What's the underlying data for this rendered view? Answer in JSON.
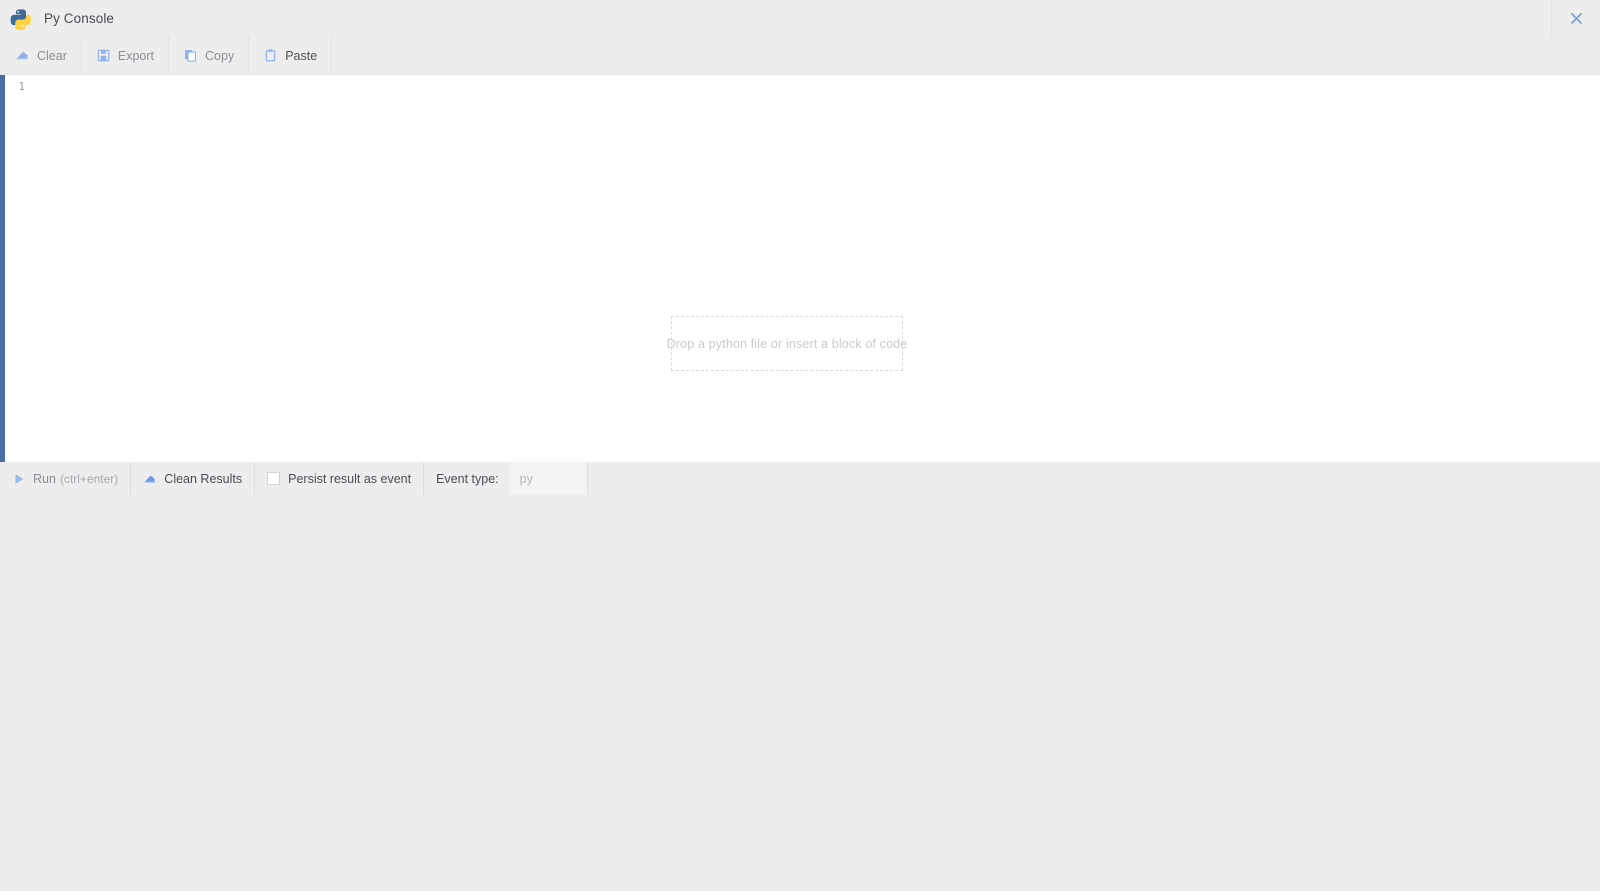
{
  "window": {
    "title": "Py Console",
    "logo_icon": "python-logo-icon",
    "close_icon": "close-icon",
    "close_label": "×"
  },
  "top_toolbar": {
    "buttons": [
      {
        "label": "Clear",
        "icon": "eraser-icon",
        "enabled": false
      },
      {
        "label": "Export",
        "icon": "floppy-disk-icon",
        "enabled": false
      },
      {
        "label": "Copy",
        "icon": "copy-icon",
        "enabled": false
      },
      {
        "label": "Paste",
        "icon": "clipboard-icon",
        "enabled": true
      }
    ]
  },
  "editor": {
    "line_numbers": [
      "1"
    ],
    "content": "",
    "dropzone_text": "Drop a python file or insert a block of code",
    "accent_color": "#4a6fa5"
  },
  "bottom_toolbar": {
    "run": {
      "label": "Run",
      "hint": "(ctrl+enter)",
      "icon": "play-icon",
      "enabled": false
    },
    "clean_results": {
      "label": "Clean Results",
      "icon": "eraser-icon",
      "enabled": true
    },
    "persist": {
      "label": "Persist result as event",
      "checked": false
    },
    "event_type": {
      "label": "Event type:",
      "value": "",
      "placeholder": "py"
    }
  },
  "colors": {
    "chrome": "#ededed",
    "editor_bg": "#ffffff",
    "accent_blue": "#4a6fa5",
    "icon_blue": "#7ba3e0"
  }
}
